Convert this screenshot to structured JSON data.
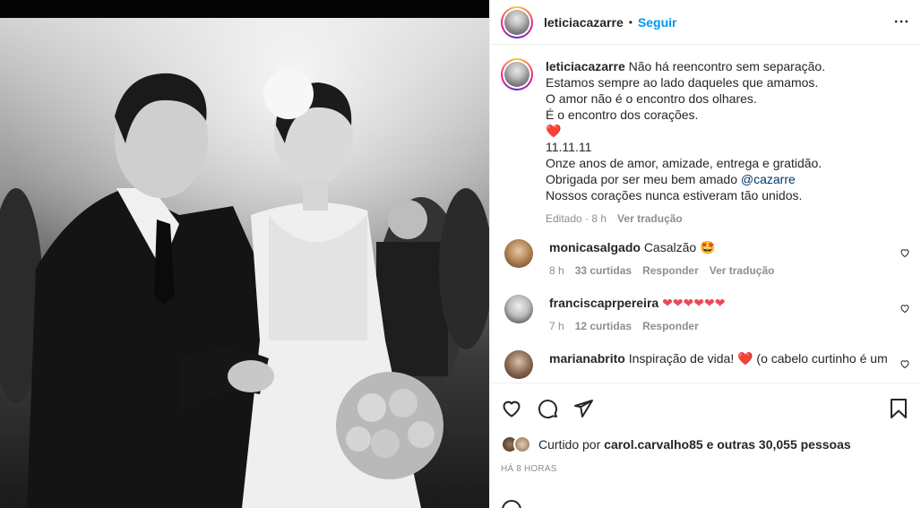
{
  "header": {
    "username": "leticiacazarre",
    "separator": "•",
    "follow_label": "Seguir"
  },
  "caption": {
    "username": "leticiacazarre",
    "lines": [
      "Não há reencontro sem separação.",
      "Estamos sempre ao lado daqueles que amamos.",
      "O amor não é o encontro dos olhares.",
      "É o encontro dos corações.",
      "❤️",
      "11.11.11",
      "Onze anos de amor, amizade, entrega e gratidão.",
      "Obrigada por ser meu bem amado",
      "Nossos corações nunca estiveram tão unidos."
    ],
    "mention": "@cazarre",
    "edited": "Editado · 8 h",
    "translate": "Ver tradução"
  },
  "comments": [
    {
      "username": "monicasalgado",
      "text": "Casalzão 🤩",
      "time": "8 h",
      "likes": "33 curtidas",
      "reply": "Responder",
      "translate": "Ver tradução"
    },
    {
      "username": "franciscaprpereira",
      "text": "❤❤❤❤❤❤",
      "time": "7 h",
      "likes": "12 curtidas",
      "reply": "Responder"
    },
    {
      "username": "marianabrito",
      "text": "Inspiração de vida! ❤️ (o cabelo curtinho é um"
    }
  ],
  "liked_by": {
    "prefix": "Curtido por",
    "user": "carol.carvalho85",
    "suffix": "e outras 30,055 pessoas"
  },
  "timestamp": "HÁ 8 HORAS",
  "icons": [
    "heart-icon",
    "comment-icon",
    "share-icon",
    "bookmark-icon",
    "more-icon",
    "emoji-icon"
  ],
  "colors": {
    "link": "#0095f6",
    "muted": "#8e8e8e",
    "text": "#262626",
    "heart": "#ed4956"
  }
}
